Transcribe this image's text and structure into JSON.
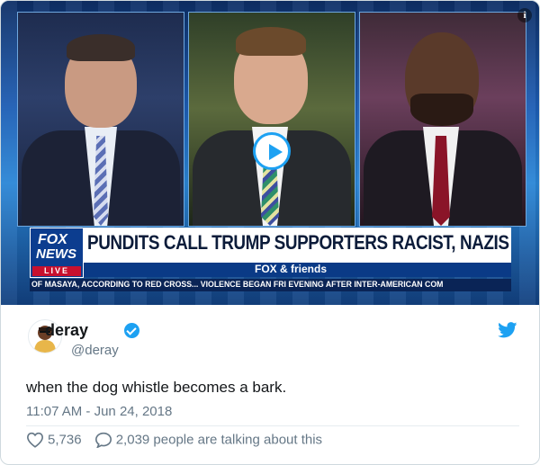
{
  "video": {
    "chyron_headline": "PUNDITS CALL TRUMP SUPPORTERS RACIST, NAZIS",
    "show_name": "FOX & friends",
    "ticker": "OF MASAYA, ACCORDING TO RED CROSS...   VIOLENCE BEGAN FRI EVENING AFTER INTER-AMERICAN COM",
    "logo_line1": "FOX",
    "logo_line2": "NEWS",
    "logo_live": "LIVE",
    "info_label": "i"
  },
  "tweet": {
    "display_name": "deray",
    "handle": "@deray",
    "text": "when the dog whistle becomes a bark.",
    "timestamp": "11:07 AM - Jun 24, 2018",
    "likes": "5,736",
    "replies_text": "2,039 people are talking about this"
  },
  "colors": {
    "twitter_blue": "#1da1f2",
    "text_primary": "#14171a",
    "text_secondary": "#657786"
  },
  "icons": [
    "info-icon",
    "play-icon",
    "verified-badge-icon",
    "twitter-bird-icon",
    "heart-icon",
    "reply-bubble-icon"
  ]
}
